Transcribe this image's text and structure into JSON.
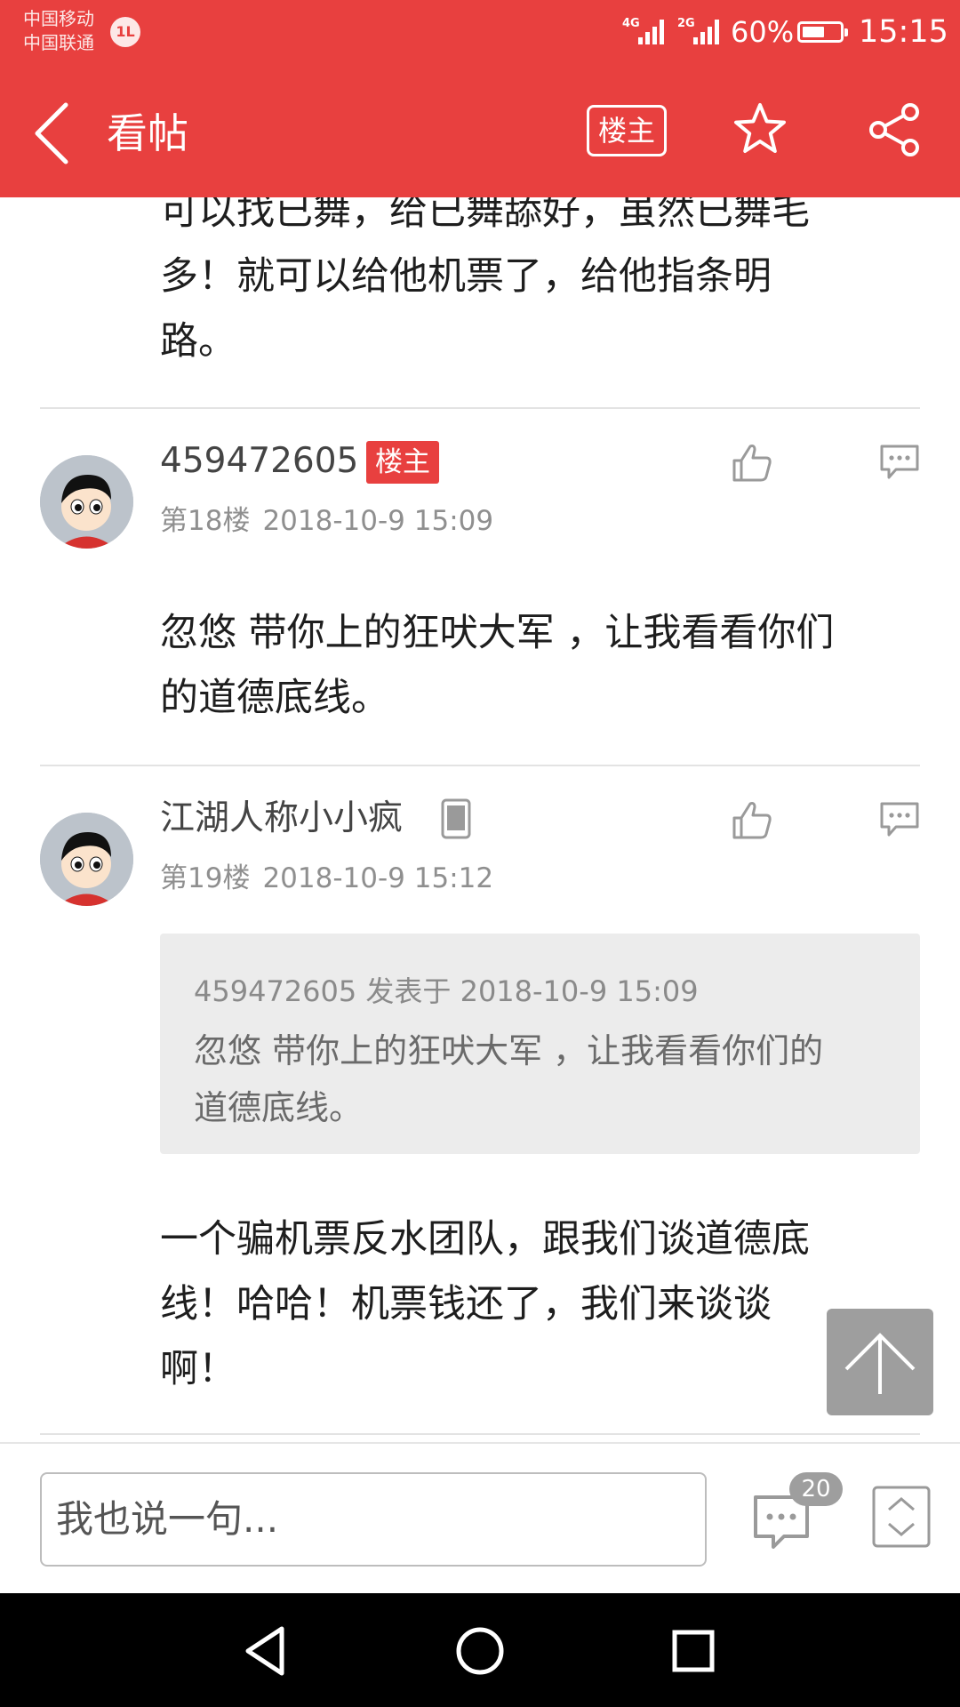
{
  "status_bar": {
    "carrier1": "中国移动",
    "carrier2": "中国联通",
    "volte_badge": "1L",
    "net1_label": "4G",
    "net2_label": "2G",
    "battery_percent": "60%",
    "battery_level": 0.6,
    "time": "15:15"
  },
  "app_bar": {
    "title": "看帖",
    "op_only_label": "楼主",
    "icons": [
      "back-icon",
      "star-icon",
      "share-icon"
    ]
  },
  "post_prev": {
    "line1": "可以找已舞，给已舞舔好，虽然已舞毛",
    "line2": "多！就可以给他机票了，给他指条明",
    "line3": "路。"
  },
  "posts": [
    {
      "username": "459472605",
      "badge": "楼主",
      "floor": "第18楼",
      "date": "2018-10-9 15:09",
      "body_line1": "忽悠 带你上的狂吠大军 ，让我看看你们",
      "body_line2": "的道德底线。"
    },
    {
      "username": "江湖人称小小疯",
      "device_icon": "phone-icon",
      "floor": "第19楼",
      "date": "2018-10-9 15:12",
      "quote_head": "459472605 发表于 2018-10-9 15:09",
      "quote_line1": "忽悠 带你上的狂吠大军 ，让我看看你们的",
      "quote_line2": "道德底线。",
      "body_line1": "一个骗机票反水团队，跟我们谈道德底",
      "body_line2": "线！哈哈！机票钱还了，我们来谈谈",
      "body_line3": "啊！"
    }
  ],
  "bottom_bar": {
    "input_placeholder": "我也说一句...",
    "comment_count": "20"
  },
  "colors": {
    "accent": "#e8403f",
    "text": "#1e1e1e",
    "meta": "#8f8f8f",
    "quote_bg": "#ececec"
  }
}
